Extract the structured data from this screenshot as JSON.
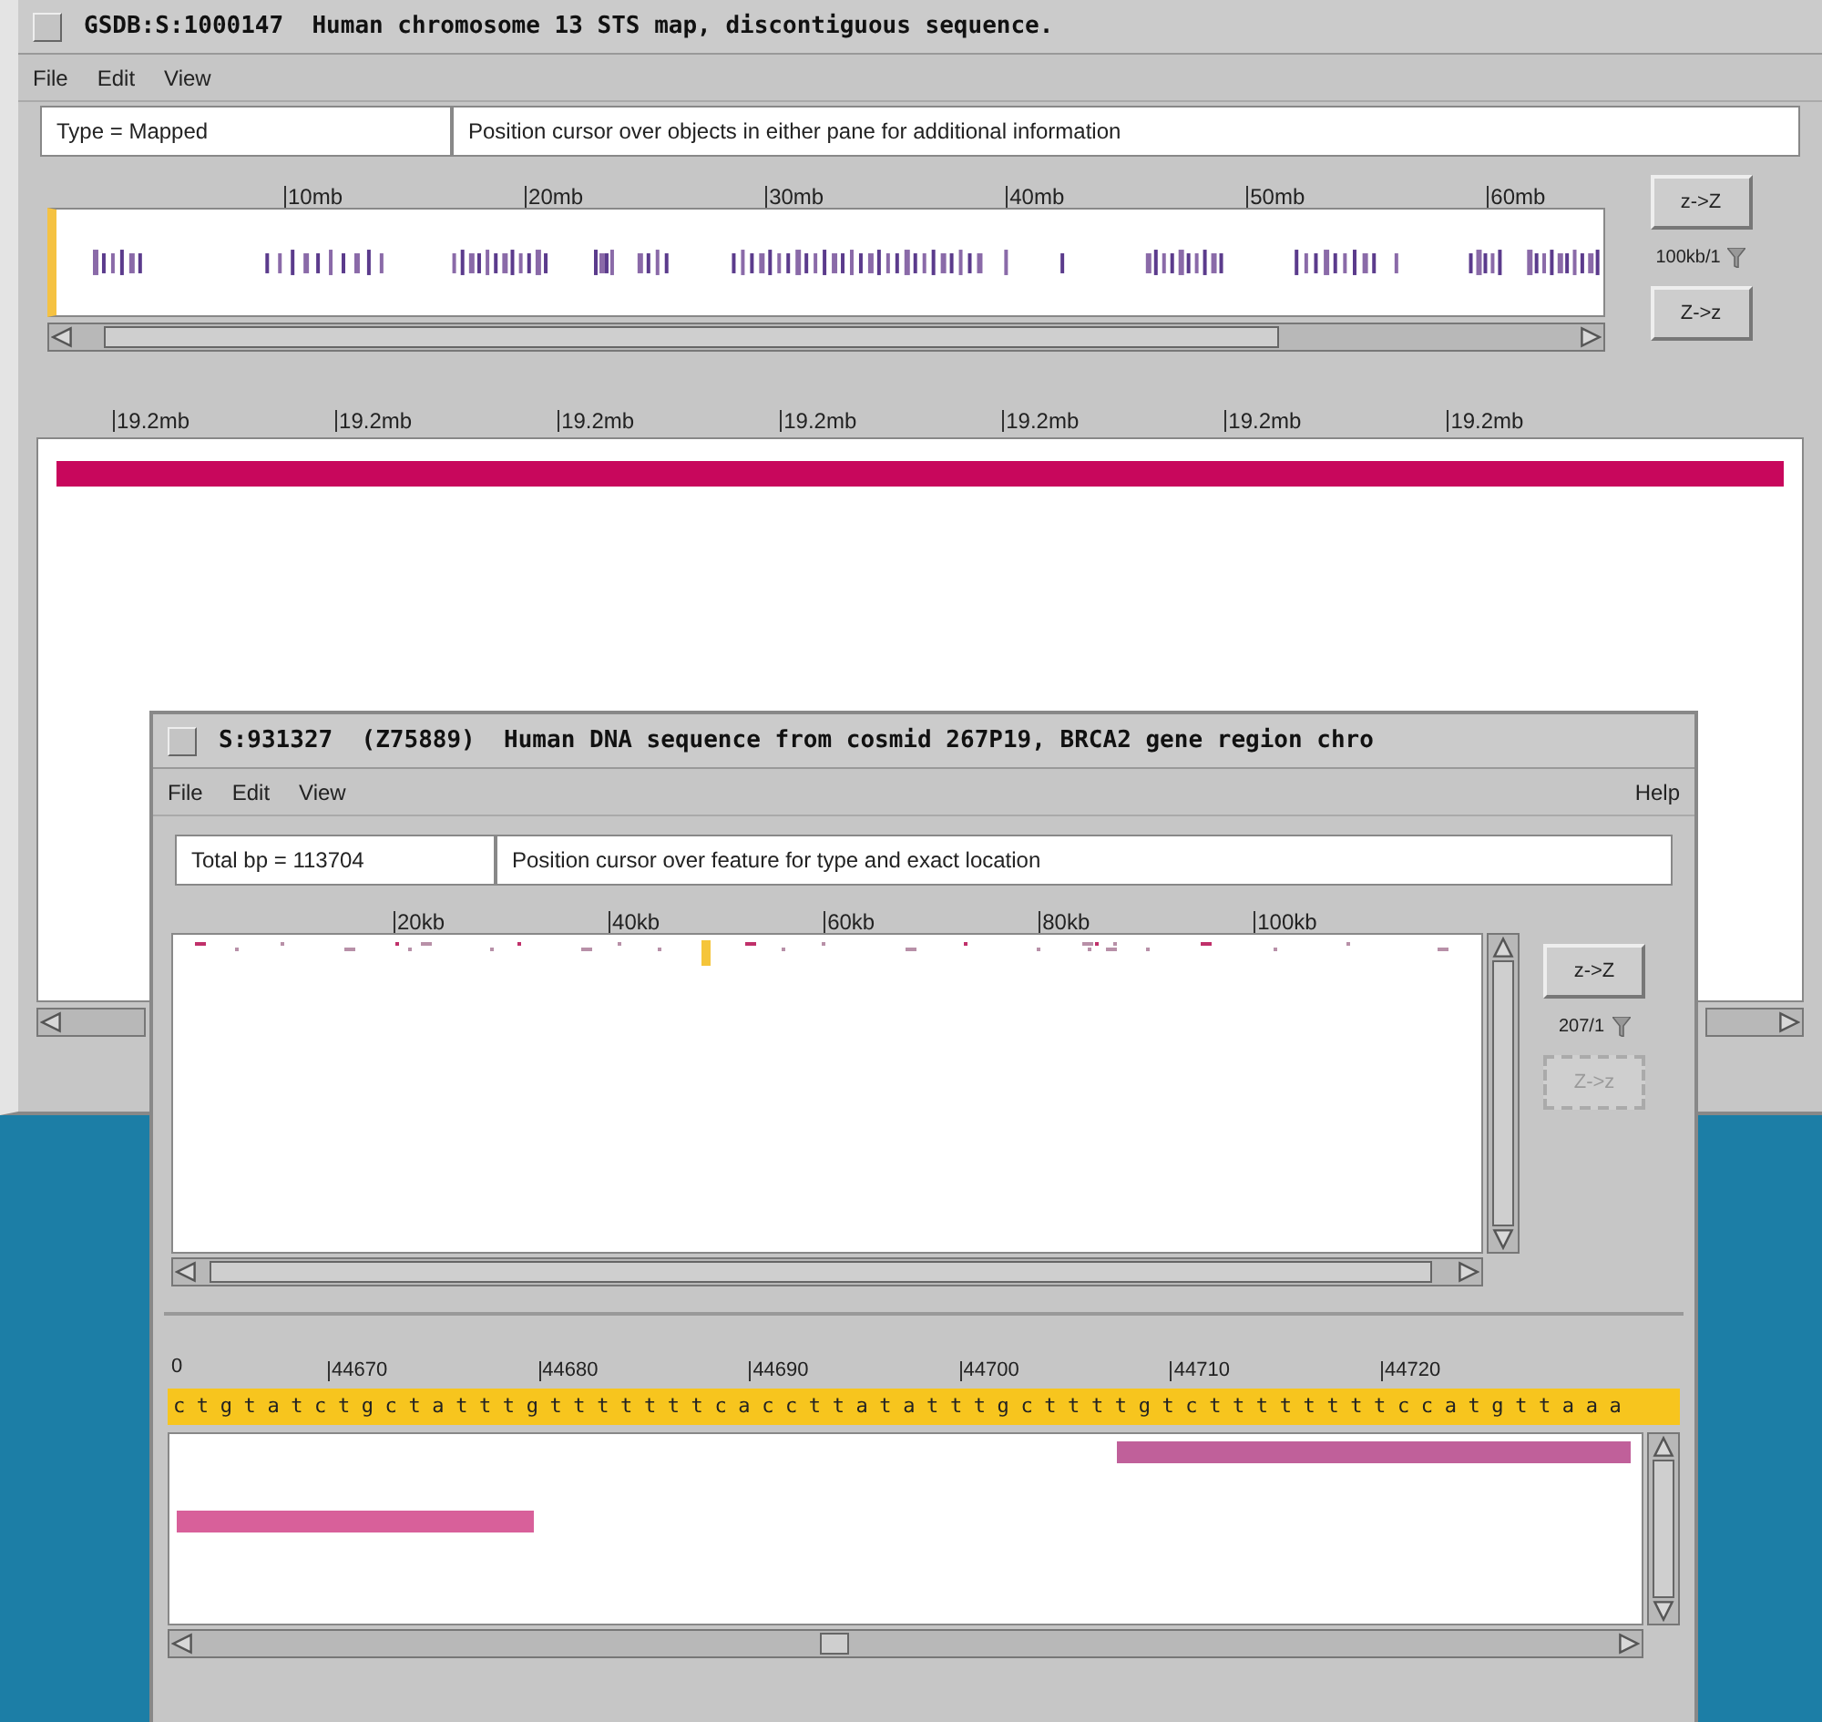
{
  "map_window": {
    "title": "GSDB:S:1000147  Human chromosome 13 STS map, discontiguous sequence.",
    "menu": [
      {
        "label": "File"
      },
      {
        "label": "Edit"
      },
      {
        "label": "View"
      }
    ],
    "status": {
      "left": "Type = Mapped",
      "message": "Position cursor over objects in either pane for additional information"
    },
    "overview_ticks": [
      "10mb",
      "20mb",
      "30mb",
      "40mb",
      "50mb",
      "60mb"
    ],
    "zoom_in": {
      "label": "z->Z",
      "disabled": false
    },
    "scale": "100kb/1",
    "zoom_out": {
      "label": "Z->z",
      "disabled": false
    },
    "detail_ticks": [
      "19.2mb",
      "19.2mb",
      "19.2mb",
      "19.2mb",
      "19.2mb",
      "19.2mb",
      "19.2mb"
    ]
  },
  "sequence_window": {
    "title": "S:931327  (Z75889)  Human DNA sequence from cosmid 267P19, BRCA2 gene region chro",
    "menu": [
      {
        "label": "File"
      },
      {
        "label": "Edit"
      },
      {
        "label": "View"
      }
    ],
    "help": "Help",
    "status": {
      "left": "Total bp = 113704",
      "message": "Position cursor over feature for type and exact location"
    },
    "feature_ticks": [
      "20kb",
      "40kb",
      "60kb",
      "80kb",
      "100kb"
    ],
    "zoom_in": {
      "label": "z->Z",
      "disabled": false
    },
    "scale": "207/1",
    "zoom_out": {
      "label": "Z->z",
      "disabled": true
    },
    "first_tick": "0",
    "base_ticks": [
      "44670",
      "44680",
      "44690",
      "44700",
      "44710",
      "44720"
    ],
    "sequence": "ctgtatctgctatttgtttttttcaccttatatttgcttttgtcttttttttccatgttaaa"
  }
}
